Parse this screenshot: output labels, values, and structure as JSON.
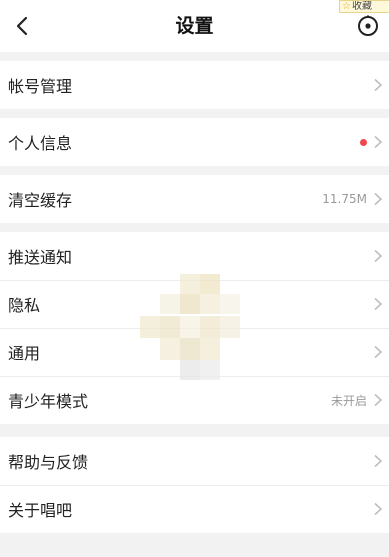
{
  "header": {
    "title": "设置",
    "back_icon": "chevron-left-icon",
    "right_icon": "target-circle-icon",
    "favorite_label": "收藏"
  },
  "groups": [
    {
      "items": [
        {
          "label": "帐号管理"
        }
      ]
    },
    {
      "items": [
        {
          "label": "个人信息",
          "badge": "red-dot"
        }
      ]
    },
    {
      "items": [
        {
          "label": "清空缓存",
          "value": "11.75M"
        }
      ]
    },
    {
      "items": [
        {
          "label": "推送通知"
        },
        {
          "label": "隐私"
        },
        {
          "label": "通用"
        },
        {
          "label": "青少年模式",
          "value": "未开启"
        }
      ]
    },
    {
      "items": [
        {
          "label": "帮助与反馈"
        },
        {
          "label": "关于唱吧"
        }
      ]
    }
  ],
  "colors": {
    "background": "#f2f2f2",
    "card": "#ffffff",
    "badge_red": "#f0474d",
    "value_gray": "#9a9a9a"
  }
}
